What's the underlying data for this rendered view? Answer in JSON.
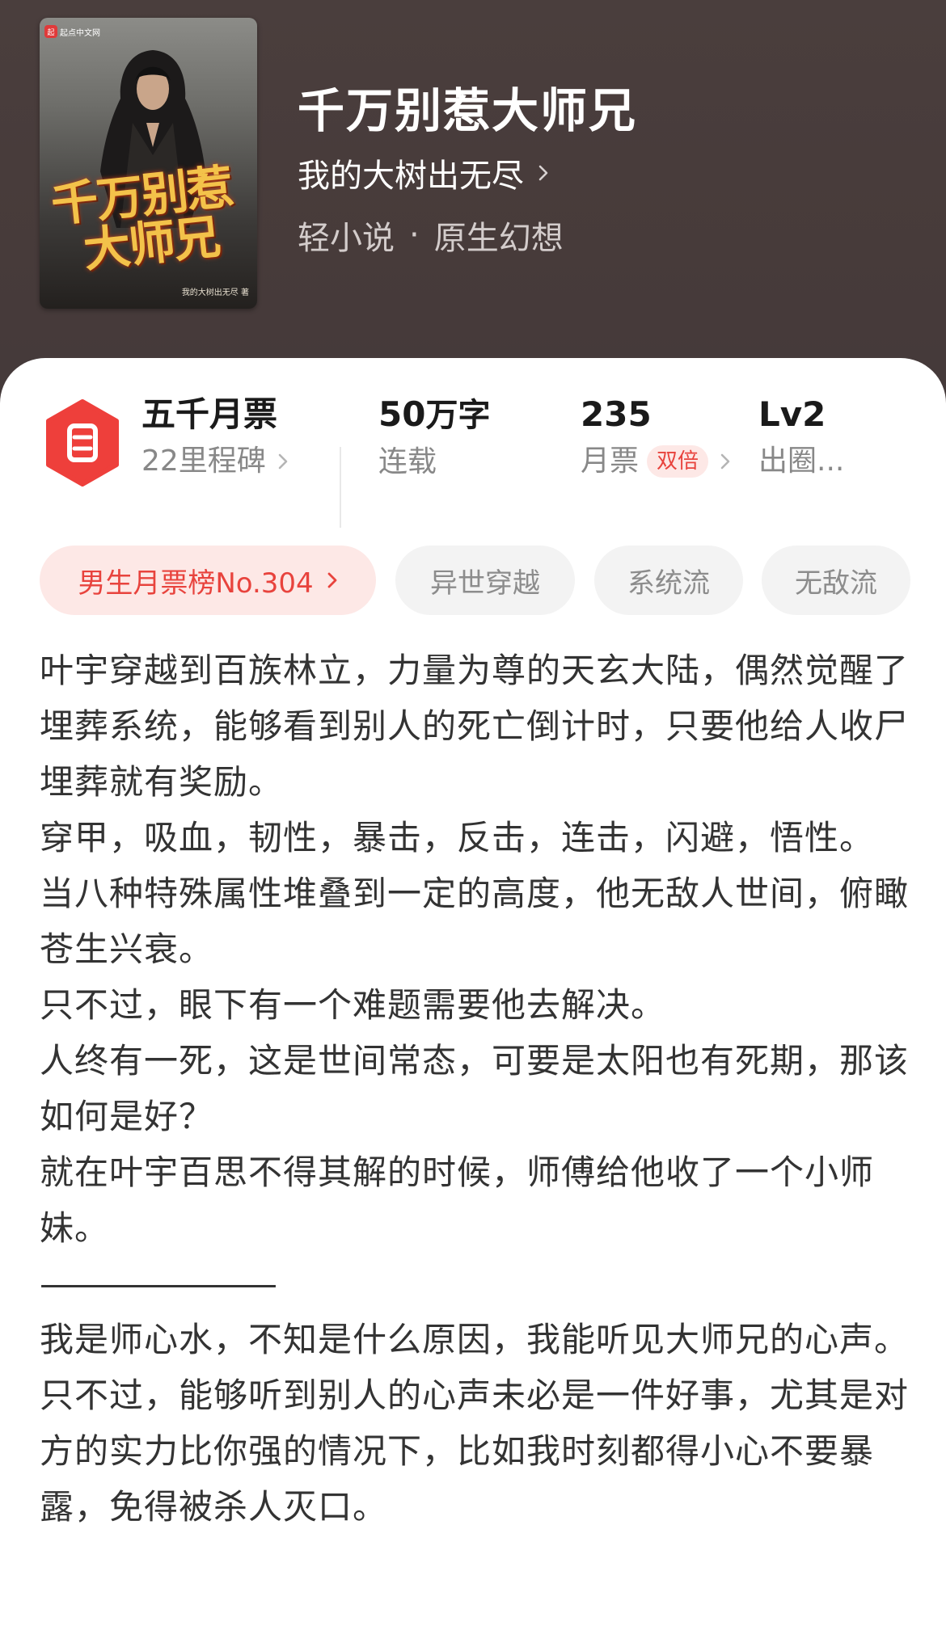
{
  "book": {
    "cover_logo": "起点中文网",
    "cover_title_line1": "千万别惹",
    "cover_title_line2": "大师兄",
    "cover_author": "我的大树出无尽 著",
    "title": "千万别惹大师兄",
    "author": "我的大树出无尽",
    "category": "轻小说",
    "separator": "·",
    "subcategory": "原生幻想"
  },
  "stats": {
    "monthly_ticket_title": "五千月票",
    "milestones": "22里程碑",
    "word_count_value": "50",
    "word_count_unit": "万字",
    "status": "连载",
    "monthly_tickets_value": "235",
    "monthly_tickets_label": "月票",
    "double_badge": "双倍",
    "level_value": "Lv2",
    "level_label": "出圈..."
  },
  "tags": [
    {
      "label": "男生月票榜No.304"
    },
    {
      "label": "异世穿越"
    },
    {
      "label": "系统流"
    },
    {
      "label": "无敌流"
    }
  ],
  "synopsis": [
    "叶宇穿越到百族林立，力量为尊的天玄大陆，偶然觉醒了埋葬系统，能够看到别人的死亡倒计时，只要他给人收尸埋葬就有奖励。",
    "穿甲，吸血，韧性，暴击，反击，连击，闪避，悟性。",
    "当八种特殊属性堆叠到一定的高度，他无敌人世间，俯瞰苍生兴衰。",
    "只不过，眼下有一个难题需要他去解决。",
    "人终有一死，这是世间常态，可要是太阳也有死期，那该如何是好？",
    "就在叶宇百思不得其解的时候，师傅给他收了一个小师妹。",
    "————————",
    "我是师心水，不知是什么原因，我能听见大师兄的心声。",
    "只不过，能够听到别人的心声未必是一件好事，尤其是对方的实力比你强的情况下，比如我时刻都得小心不要暴露，免得被杀人灭口。"
  ],
  "colors": {
    "header_bg": "#473b3a",
    "accent_red": "#e8433d",
    "badge_bg": "#fde8e6",
    "tag_bg": "#f3f3f3"
  },
  "icons": [
    "chevron-right-icon",
    "monthly-ticket-icon"
  ]
}
